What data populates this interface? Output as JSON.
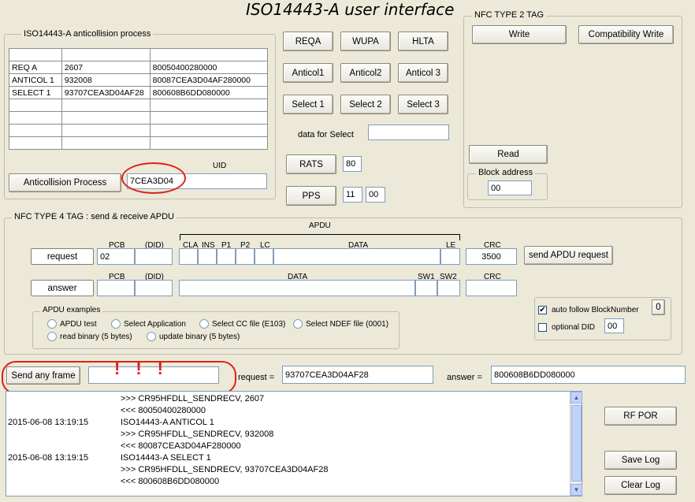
{
  "window_title": "ISO14443-A user interface",
  "anticollision": {
    "group_label": "ISO14443-A anticollision process",
    "rows": [
      {
        "name": "REQ A",
        "val1": "2607",
        "val2": "80050400280000"
      },
      {
        "name": "ANTICOL 1",
        "val1": "932008",
        "val2": "80087CEA3D04AF280000"
      },
      {
        "name": "SELECT 1",
        "val1": "93707CEA3D04AF28",
        "val2": "800608B6DD080000"
      },
      {
        "name": "",
        "val1": "",
        "val2": ""
      },
      {
        "name": "",
        "val1": "",
        "val2": ""
      },
      {
        "name": "",
        "val1": "",
        "val2": ""
      },
      {
        "name": "",
        "val1": "",
        "val2": ""
      }
    ],
    "button": "Anticollision Process",
    "uid_label": "UID",
    "uid_value": "7CEA3D04"
  },
  "commands": {
    "reqa": "REQA",
    "wupa": "WUPA",
    "hlta": "HLTA",
    "anticol1": "Anticol1",
    "anticol2": "Anticol2",
    "anticol3": "Anticol 3",
    "select1": "Select 1",
    "select2": "Select 2",
    "select3": "Select 3",
    "data_for_select_label": "data for Select",
    "data_for_select_value": "",
    "rats": "RATS",
    "rats_value": "80",
    "pps": "PPS",
    "pps_value1": "11",
    "pps_value2": "00"
  },
  "nfc2": {
    "group_label": "NFC TYPE 2 TAG",
    "write": "Write",
    "compat_write": "Compatibility Write",
    "read": "Read",
    "block_label": "Block address",
    "block_value": "00"
  },
  "nfc4": {
    "group_label": "NFC TYPE 4 TAG : send & receive APDU",
    "apdu_label": "APDU",
    "request_label": "request",
    "answer_label": "answer",
    "col_pcb": "PCB",
    "col_did": "(DID)",
    "col_cla": "CLA",
    "col_ins": "INS",
    "col_p1": "P1",
    "col_p2": "P2",
    "col_lc": "LC",
    "col_data": "DATA",
    "col_le": "LE",
    "col_crc": "CRC",
    "col_sw1": "SW1",
    "col_sw2": "SW2",
    "req_pcb": "02",
    "req_crc": "3500",
    "send_button": "send APDU request",
    "auto_follow_label": "auto follow BlockNumber",
    "auto_follow_checked": true,
    "block_number": "0",
    "optional_did_label": "optional DID",
    "optional_did_checked": false,
    "optional_did_value": "00",
    "examples_label": "APDU examples",
    "examples": [
      "APDU test",
      "Select Application",
      "Select CC file (E103)",
      "Select NDEF file (0001)",
      "read binary (5 bytes)",
      "update binary (5 bytes)"
    ]
  },
  "frame": {
    "send_button": "Send any frame",
    "frame_value": "",
    "request_label": "request =",
    "request_value": "93707CEA3D04AF28",
    "answer_label": "answer =",
    "answer_value": "800608B6DD080000"
  },
  "log": {
    "lines": [
      {
        "time": "",
        "text": ">>> CR95HFDLL_SENDRECV, 2607"
      },
      {
        "time": "",
        "text": "<<< 80050400280000"
      },
      {
        "time": "2015-06-08 13:19:15",
        "text": "ISO14443-A ANTICOL 1"
      },
      {
        "time": "",
        "text": ">>> CR95HFDLL_SENDRECV, 932008"
      },
      {
        "time": "",
        "text": "<<< 80087CEA3D04AF280000"
      },
      {
        "time": "2015-06-08 13:19:15",
        "text": "ISO14443-A SELECT 1"
      },
      {
        "time": "",
        "text": ">>> CR95HFDLL_SENDRECV, 93707CEA3D04AF28"
      },
      {
        "time": "",
        "text": "<<< 800608B6DD080000"
      }
    ]
  },
  "side_buttons": {
    "rf_por": "RF POR",
    "save_log": "Save Log",
    "clear_log": "Clear Log"
  },
  "annotation_marks": "!!!",
  "colors": {
    "annotation": "#e0201a",
    "background": "#ece9d8",
    "field_border": "#7f9db9"
  }
}
